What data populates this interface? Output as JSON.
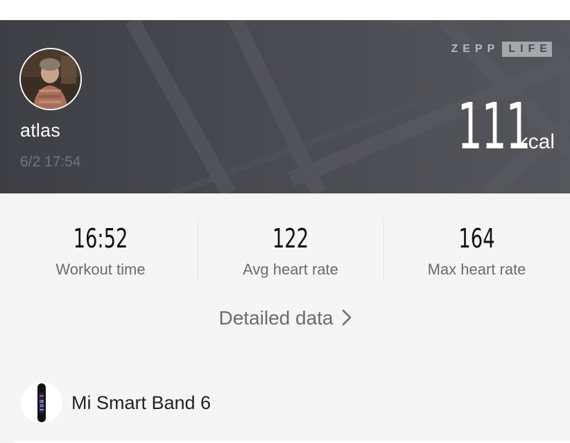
{
  "header": {
    "username": "atlas",
    "datetime": "6/2 17:54",
    "brand_primary": "ZEPP",
    "brand_secondary": "LIFE",
    "calories_value": "111",
    "calories_unit": "kcal"
  },
  "stats": [
    {
      "value": "16:52",
      "label": "Workout time"
    },
    {
      "value": "122",
      "label": "Avg heart rate"
    },
    {
      "value": "164",
      "label": "Max heart rate"
    }
  ],
  "detail_link": {
    "label": "Detailed data",
    "icon": "chevron-right-icon"
  },
  "device": {
    "name": "Mi Smart Band 6",
    "icon": "smart-band-icon"
  },
  "colors": {
    "header_bg": "#4a4b50",
    "page_bg": "#f5f5f5",
    "accent_white": "#ffffff"
  }
}
